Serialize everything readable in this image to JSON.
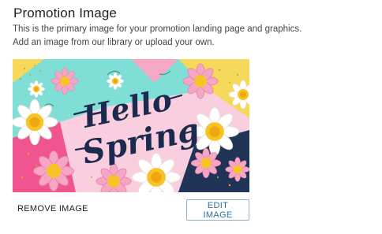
{
  "section": {
    "title": "Promotion Image",
    "description_line1": "This is the primary image for your promotion landing page and graphics.",
    "description_line2": "Add an image from our library or upload your own."
  },
  "image": {
    "text_line1": "Hello",
    "text_line2": "Spring"
  },
  "actions": {
    "remove_label": "REMOVE IMAGE",
    "edit_label": "EDIT IMAGE"
  }
}
